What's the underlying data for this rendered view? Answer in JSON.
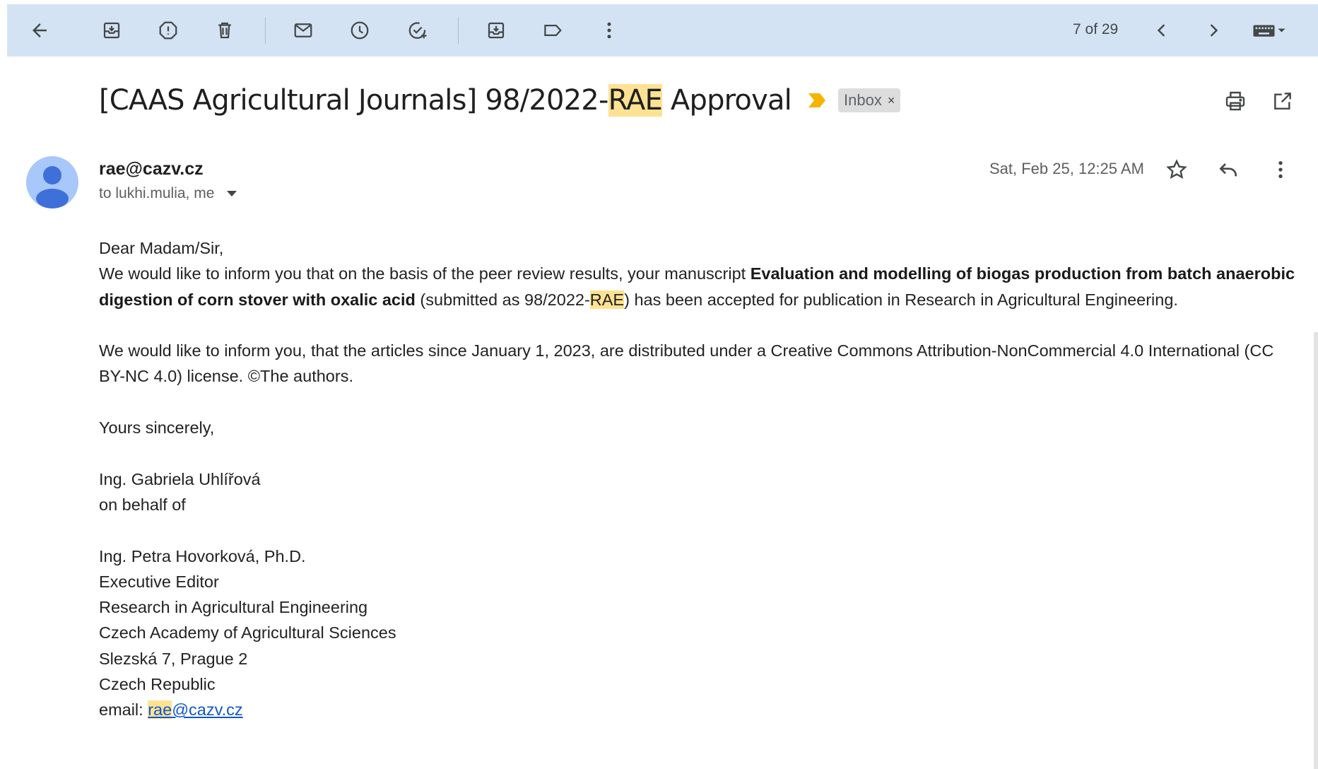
{
  "toolbar": {
    "pager": "7 of 29",
    "icons": [
      "back-arrow-icon",
      "archive-icon",
      "report-spam-icon",
      "delete-icon",
      "mark-unread-icon",
      "snooze-icon",
      "add-task-icon",
      "move-to-icon",
      "label-icon",
      "more-vert-icon",
      "prev-icon",
      "next-icon",
      "keyboard-icon"
    ]
  },
  "email": {
    "subject_prefix": "[CAAS Agricultural Journals] 98/2022-",
    "subject_highlight": "RAE",
    "subject_suffix": " Approval",
    "label": "Inbox",
    "label_close": "×",
    "sender": "rae@cazv.cz",
    "recipients": "to lukhi.mulia, me",
    "date": "Sat, Feb 25, 12:25 AM",
    "body": {
      "greeting": "Dear Madam/Sir,",
      "p1_start": "We would like to inform you that on the basis of the peer review results, your manuscript ",
      "p1_title": "Evaluation and modelling of biogas production from batch anaerobic digestion of corn stover with oxalic acid",
      "p1_mid": " (submitted as 98/2022-",
      "p1_highlight": "RAE",
      "p1_end": ") has been accepted for publication in Research in Agricultural Engineering.",
      "p2": "We would like to inform you, that the articles since January 1, 2023, are distributed under a Creative Commons Attribution-NonCommercial 4.0 International (CC BY-NC 4.0) license. ©The authors.",
      "closing": "Yours sincerely,",
      "sig1": "Ing. Gabriela Uhlířová",
      "sig2": "on behalf of",
      "sig3": "Ing. Petra Hovorková, Ph.D.",
      "sig4": "Executive Editor",
      "sig5": "Research in Agricultural Engineering",
      "sig6": "Czech Academy of Agricultural Sciences",
      "sig7": "Slezská 7, Prague 2",
      "sig8": "Czech Republic",
      "email_label": "email: ",
      "email_highlight": "rae",
      "email_rest": "@cazv.cz"
    }
  },
  "colors": {
    "toolbar_bg": "#d3e3f4",
    "highlight": "#fde293",
    "important_marker": "#f4b400",
    "link": "#1155cc"
  }
}
